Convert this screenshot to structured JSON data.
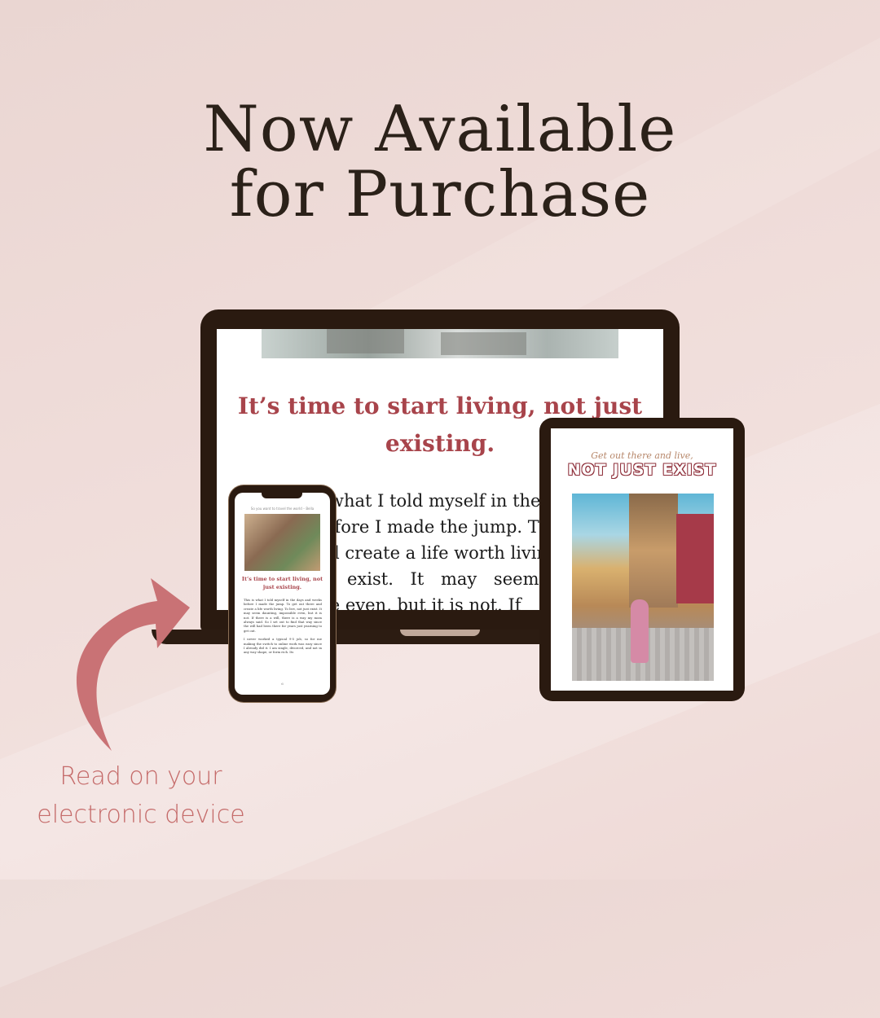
{
  "headline": {
    "line1": "Now Available",
    "line2": "for Purchase"
  },
  "laptop": {
    "title": "It’s time to start living, not just existing.",
    "body_lines": [
      "what I told myself in the",
      "efore I made the jump. T",
      "l create a life worth living",
      "exist. It may seem",
      "le even, but it is not. If"
    ]
  },
  "tablet": {
    "script_line": "Get out there and live,",
    "title": "NOT JUST EXIST"
  },
  "phone": {
    "top_line": "So you want to travel the world – Bella",
    "title": "It’s time to start living, not just existing.",
    "para1": "This is what I told myself in the days and weeks before I made the jump. To get out there and create a life worth living. To live, not just exist. It may seem daunting, impossible even, but it is not. If there is a will, there is a way my mom always said. So I set out to find that way since the will had been there for years just yearning to get out.",
    "para2": "I never worked a typical 9-5 job, so for me making the switch to online work was easy since I already did it. I am single, divorced, and not in any way shape, or form rich. Its",
    "page_number": "6"
  },
  "caption": {
    "line1": "Read on your",
    "line2": "electronic device"
  },
  "colors": {
    "accent_red": "#a8444b",
    "arrow_pink": "#c97275",
    "device_frame": "#2a1a10"
  }
}
